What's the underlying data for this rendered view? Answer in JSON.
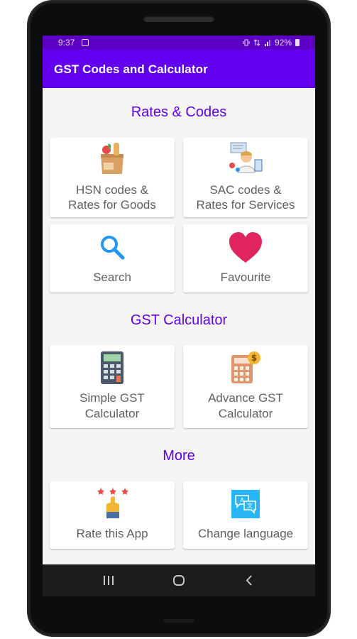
{
  "status_bar": {
    "time": "9:37",
    "battery": "92%",
    "notification_icon": "gallery-notification-icon"
  },
  "app": {
    "title": "GST Codes and Calculator"
  },
  "sections": {
    "rates_codes": {
      "title": "Rates & Codes",
      "items": [
        {
          "line1": "HSN codes &",
          "line2": "Rates for Goods",
          "icon": "grocery-bag-icon"
        },
        {
          "line1": "SAC codes &",
          "line2": "Rates for Services",
          "icon": "services-person-icon"
        },
        {
          "line1": "Search",
          "icon": "search-icon"
        },
        {
          "line1": "Favourite",
          "icon": "heart-icon"
        }
      ]
    },
    "calculator": {
      "title": "GST Calculator",
      "items": [
        {
          "line1": "Simple GST",
          "line2": "Calculator",
          "icon": "calculator-icon"
        },
        {
          "line1": "Advance GST",
          "line2": "Calculator",
          "icon": "calculator-dollar-icon"
        }
      ]
    },
    "more": {
      "title": "More",
      "items": [
        {
          "line1": "Rate this App",
          "icon": "rating-stars-icon"
        },
        {
          "line1": "Change language",
          "icon": "translate-chat-icon"
        }
      ]
    }
  },
  "colors": {
    "primary": "#6200ee",
    "status_bar": "#5c00c4",
    "section_title": "#6200ee",
    "heart": "#e0245e",
    "search": "#2196f3"
  }
}
